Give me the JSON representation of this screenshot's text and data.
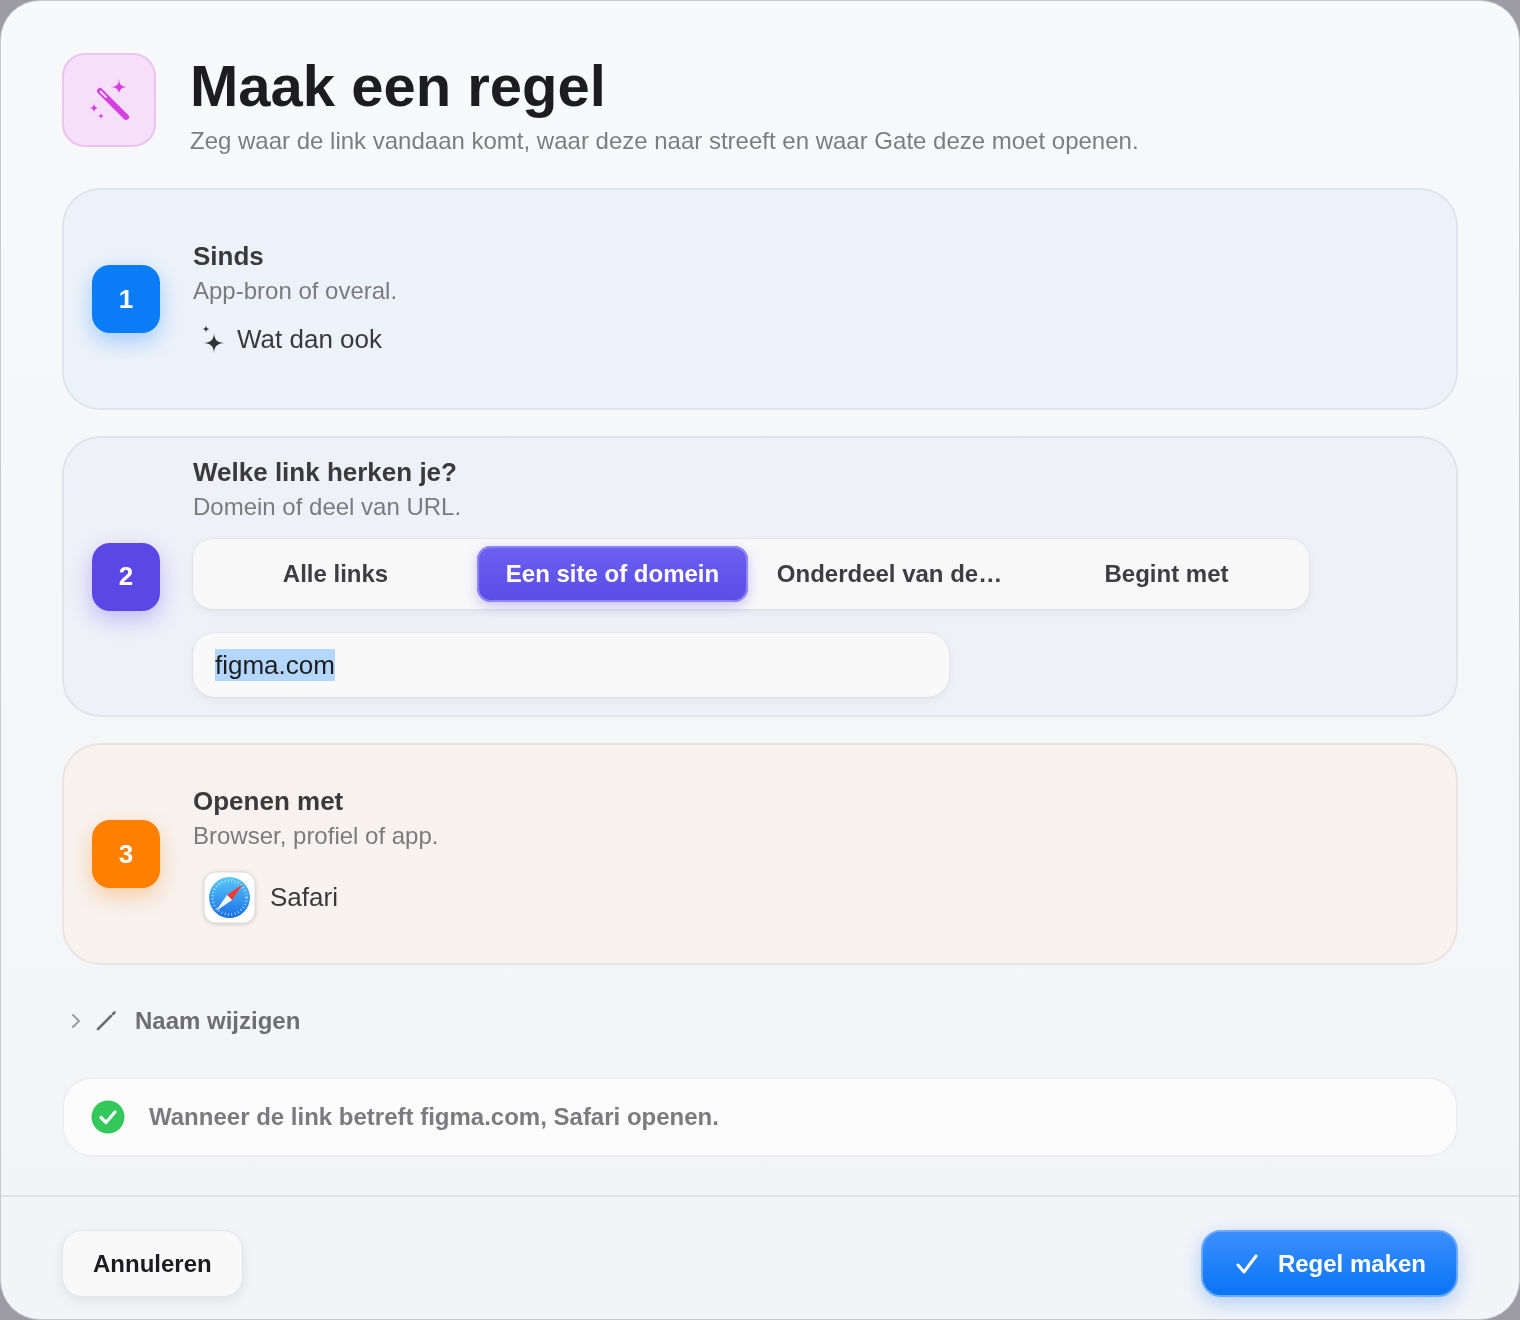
{
  "window": {
    "title": "Maak een regel",
    "subtitle": "Zeg waar de link vandaan komt, waar deze naar streeft en waar Gate deze moet openen."
  },
  "steps": [
    {
      "kind": "source",
      "number": "1",
      "color": "#0a7cf5",
      "title": "Sinds",
      "description": "App-bron of overal.",
      "value": "Wat dan ook"
    },
    {
      "kind": "match",
      "number": "2",
      "color": "#5b47e6",
      "title": "Welke link herken je?",
      "description": "Domein of deel van URL.",
      "options": [
        {
          "label": "Alle links",
          "selected": false
        },
        {
          "label": "Een site of domein",
          "selected": true
        },
        {
          "label": "Onderdeel van de…",
          "selected": false
        },
        {
          "label": "Begint met",
          "selected": false
        }
      ],
      "field": {
        "value": "figma.com",
        "text_selected": true
      }
    },
    {
      "kind": "app",
      "number": "3",
      "color": "#ff7f00",
      "title": "Openen met",
      "description": "Browser, profiel of app.",
      "value": "Safari"
    }
  ],
  "rename": {
    "label": "Naam wijzigen",
    "expanded": false
  },
  "summary": {
    "text": "Wanneer de link betreft figma.com, Safari openen."
  },
  "buttons": [
    {
      "kind": "secondary",
      "label": "Annuleren"
    },
    {
      "kind": "primary",
      "label": "Regel maken"
    }
  ]
}
